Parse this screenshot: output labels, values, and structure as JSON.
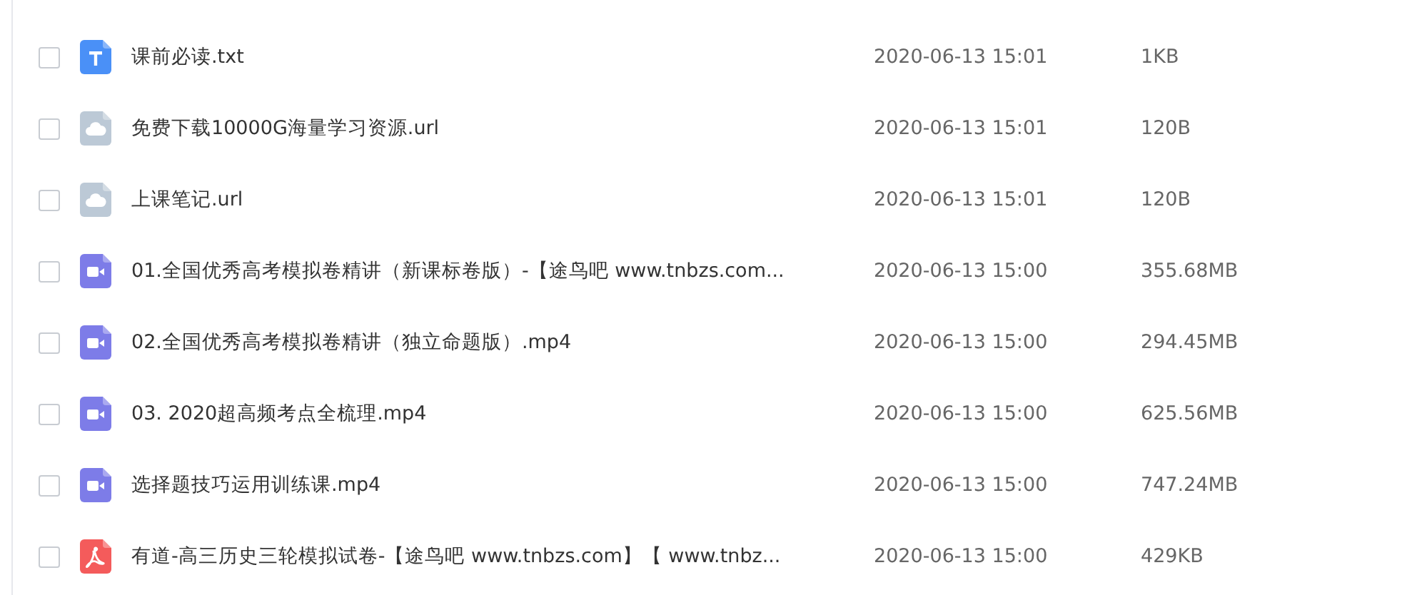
{
  "files": [
    {
      "kind": "txt",
      "name": "课前必读.txt",
      "modified": "2020-06-13 15:01",
      "size": "1KB",
      "checked": false
    },
    {
      "kind": "link",
      "name": "免费下载10000G海量学习资源.url",
      "modified": "2020-06-13 15:01",
      "size": "120B",
      "checked": false
    },
    {
      "kind": "link",
      "name": "上课笔记.url",
      "modified": "2020-06-13 15:01",
      "size": "120B",
      "checked": false
    },
    {
      "kind": "video",
      "name": "01.全国优秀高考模拟卷精讲（新课标卷版）-【途鸟吧 www.tnbzs.com...",
      "modified": "2020-06-13 15:00",
      "size": "355.68MB",
      "checked": false
    },
    {
      "kind": "video",
      "name": "02.全国优秀高考模拟卷精讲（独立命题版）.mp4",
      "modified": "2020-06-13 15:00",
      "size": "294.45MB",
      "checked": false
    },
    {
      "kind": "video",
      "name": "03. 2020超高频考点全梳理.mp4",
      "modified": "2020-06-13 15:00",
      "size": "625.56MB",
      "checked": false
    },
    {
      "kind": "video",
      "name": "选择题技巧运用训练课.mp4",
      "modified": "2020-06-13 15:00",
      "size": "747.24MB",
      "checked": false
    },
    {
      "kind": "pdf",
      "name": "有道-高三历史三轮模拟试卷-【途鸟吧 www.tnbzs.com】【 www.tnbz...",
      "modified": "2020-06-13 15:00",
      "size": "429KB",
      "checked": false
    }
  ]
}
